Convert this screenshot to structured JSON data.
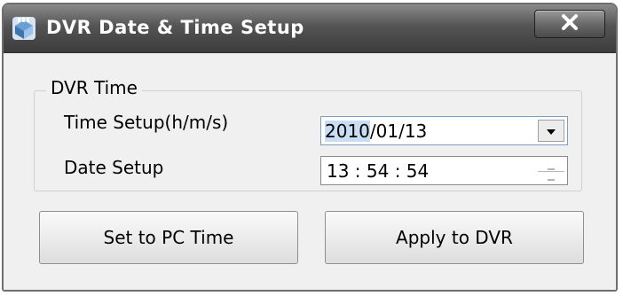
{
  "window": {
    "title": "DVR Date & Time Setup",
    "close_glyph": "X",
    "app_icon": "dvr-app-icon"
  },
  "group": {
    "label": "DVR Time"
  },
  "fields": {
    "time_label": "Time Setup(h/m/s)",
    "date_label": "Date Setup",
    "date_selected_part": "2010",
    "date_rest": "/01/13",
    "time_value": "13 : 54 : 54"
  },
  "buttons": {
    "set_pc_time": "Set to PC Time",
    "apply_dvr": "Apply to DVR"
  },
  "icons": {
    "dropdown": "chevron-down-icon",
    "spin_up": "spin-up-icon",
    "spin_down": "spin-down-icon",
    "close": "close-icon"
  },
  "colors": {
    "titlebar": "#545454",
    "window_bg": "#f0f0f0",
    "selection": "#c8ddf3"
  }
}
